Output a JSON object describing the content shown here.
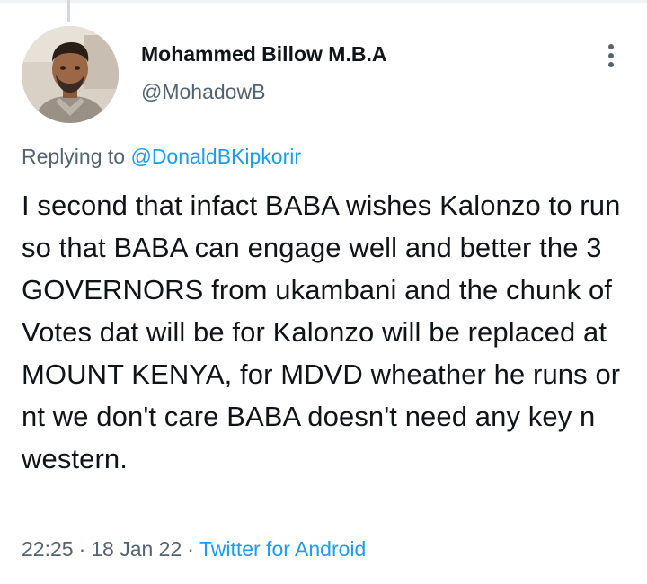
{
  "tweet": {
    "author": {
      "display_name": "Mohammed Billow M.B.A",
      "handle": "@MohadowB",
      "avatar_icon": "profile-photo"
    },
    "reply": {
      "prefix": "Replying to",
      "handle": "@DonaldBKipkorir"
    },
    "text": "I second that infact BABA wishes Kalonzo to run so that BABA can engage well and better the 3 GOVERNORS from ukambani and the chunk of Votes dat will be for Kalonzo will be replaced at MOUNT KENYA, for MDVD wheather he runs or nt we don't care BABA doesn't need any key n western.",
    "meta": {
      "time": "22:25",
      "separator": "·",
      "date": "18 Jan 22",
      "source": "Twitter for Android"
    },
    "more_icon": "more-vertical-icon"
  },
  "colors": {
    "text_primary": "#0f1419",
    "text_secondary": "#536471",
    "accent": "#1d9bf0",
    "divider": "#eff3f4",
    "thread_line": "#cfd9de"
  }
}
